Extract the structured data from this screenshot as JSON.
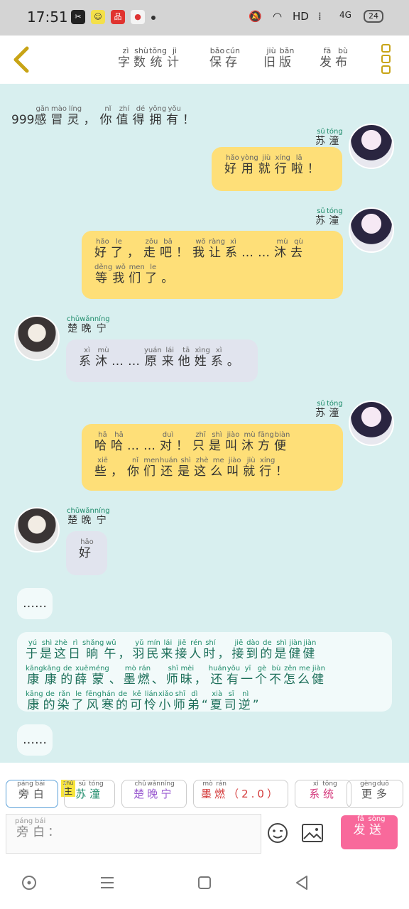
{
  "status": {
    "time": "17:51",
    "network": "HD",
    "signal": "4G",
    "battery": "24"
  },
  "header": {
    "stats": {
      "hanzi": [
        "字",
        "数",
        "统",
        "计"
      ],
      "pinyin": [
        "zì",
        "shù",
        "tǒng",
        "jì"
      ]
    },
    "save": {
      "hanzi": [
        "保",
        "存"
      ],
      "pinyin": [
        "bǎo",
        "cún"
      ]
    },
    "old": {
      "hanzi": [
        "旧",
        "版"
      ],
      "pinyin": [
        "jiù",
        "bǎn"
      ]
    },
    "publish": {
      "hanzi": [
        "发",
        "布"
      ],
      "pinyin": [
        "fā",
        "bù"
      ]
    }
  },
  "messages": {
    "m0": {
      "prefix": "999",
      "hanzi": [
        "感",
        "冒",
        "灵",
        "，",
        "你",
        "值",
        "得",
        "拥",
        "有",
        "！"
      ],
      "pinyin": [
        "gǎn",
        "mào",
        "líng",
        "",
        "nǐ",
        "zhí",
        "dé",
        "yōng",
        "yǒu",
        ""
      ]
    },
    "m1_speaker": {
      "hanzi": [
        "苏",
        "潼"
      ],
      "pinyin": [
        "sū",
        "tóng"
      ]
    },
    "m1": {
      "hanzi": [
        "好",
        "用",
        "就",
        "行",
        "啦",
        "！"
      ],
      "pinyin": [
        "hǎo",
        "yòng",
        "jiù",
        "xíng",
        "lā",
        ""
      ]
    },
    "m2_speaker": {
      "hanzi": [
        "苏",
        "潼"
      ],
      "pinyin": [
        "sū",
        "tóng"
      ]
    },
    "m2_l1": {
      "hanzi": [
        "好",
        "了",
        "，",
        "走",
        "吧",
        "！",
        "我",
        "让",
        "系",
        "……",
        "沐",
        "去"
      ],
      "pinyin": [
        "hǎo",
        "le",
        "",
        "zǒu",
        "bā",
        "",
        "wǒ",
        "ràng",
        "xì",
        "",
        "mù",
        "qù"
      ]
    },
    "m2_l2": {
      "hanzi": [
        "等",
        "我",
        "们",
        "了",
        "。"
      ],
      "pinyin": [
        "děng",
        "wǒ",
        "men",
        "le",
        ""
      ]
    },
    "m3_speaker": {
      "hanzi": [
        "楚",
        "晚",
        "宁"
      ],
      "pinyin": [
        "chǔ",
        "wǎn",
        "níng"
      ]
    },
    "m3": {
      "hanzi": [
        "系",
        "沐",
        "……",
        "原",
        "来",
        "他",
        "姓",
        "系",
        "。"
      ],
      "pinyin": [
        "xì",
        "mù",
        "",
        "yuán",
        "lái",
        "tā",
        "xìng",
        "xì",
        ""
      ]
    },
    "m4_speaker": {
      "hanzi": [
        "苏",
        "潼"
      ],
      "pinyin": [
        "sū",
        "tóng"
      ]
    },
    "m4_l1": {
      "hanzi": [
        "哈",
        "哈",
        "……",
        "对",
        "！",
        "只",
        "是",
        "叫",
        "沐",
        "方",
        "便"
      ],
      "pinyin": [
        "hā",
        "hā",
        "",
        "duì",
        "",
        "zhī",
        "shì",
        "jiào",
        "mù",
        "fāng",
        "biàn"
      ]
    },
    "m4_l2": {
      "hanzi": [
        "些",
        "，",
        "你",
        "们",
        "还",
        "是",
        "这",
        "么",
        "叫",
        "就",
        "行",
        "！"
      ],
      "pinyin": [
        "xiē",
        "",
        "nǐ",
        "men",
        "huán",
        "shì",
        "zhè",
        "me",
        "jiào",
        "jiù",
        "xíng",
        ""
      ]
    },
    "m5_speaker": {
      "hanzi": [
        "楚",
        "晚",
        "宁"
      ],
      "pinyin": [
        "chǔ",
        "wǎn",
        "níng"
      ]
    },
    "m5": {
      "hanzi": [
        "好"
      ],
      "pinyin": [
        "hǎo"
      ]
    },
    "ellipsis1": "……",
    "n1_l1": {
      "hanzi": [
        "于",
        "是",
        "这",
        "日",
        "晌",
        "午",
        "，",
        "羽",
        "民",
        "来",
        "接",
        "人",
        "时",
        "，",
        "接",
        "到",
        "的",
        "是",
        "健",
        "健"
      ],
      "pinyin": [
        "yú",
        "shì",
        "zhè",
        "rì",
        "shǎng",
        "wǔ",
        "",
        "yǔ",
        "mín",
        "lái",
        "jiē",
        "rén",
        "shí",
        "",
        "jiē",
        "dào",
        "de",
        "shì",
        "jiàn",
        "jiàn"
      ]
    },
    "n1_l2": {
      "hanzi": [
        "康",
        "康",
        "的",
        "薛",
        "蒙",
        "、",
        "墨",
        "燃",
        "、",
        "师",
        "昧",
        "，",
        "还",
        "有",
        "一",
        "个",
        "不",
        "怎",
        "么",
        "健"
      ],
      "pinyin": [
        "kāng",
        "kāng",
        "de",
        "xuē",
        "méng",
        "",
        "mò",
        "rán",
        "",
        "shī",
        "mèi",
        "",
        "huán",
        "yǒu",
        "yī",
        "gè",
        "bù",
        "zěn",
        "me",
        "jiàn"
      ]
    },
    "n1_l3": {
      "hanzi": [
        "康",
        "的",
        "染",
        "了",
        "风",
        "寒",
        "的",
        "可",
        "怜",
        "小",
        "师",
        "弟",
        "“",
        "夏",
        "司",
        "逆",
        "”"
      ],
      "pinyin": [
        "kāng",
        "de",
        "rǎn",
        "le",
        "fēng",
        "hán",
        "de",
        "kě",
        "lián",
        "xiǎo",
        "shī",
        "dì",
        "",
        "xià",
        "sī",
        "nì",
        ""
      ]
    },
    "ellipsis2": "……"
  },
  "roles": {
    "narrator": {
      "hanzi": [
        "旁",
        "白"
      ],
      "pinyin": [
        "páng",
        "bái"
      ]
    },
    "host": {
      "hanzi": [
        "主"
      ],
      "pinyin": [
        "zhǔ"
      ]
    },
    "sutong": {
      "hanzi": [
        "苏",
        "潼"
      ],
      "pinyin": [
        "sū",
        "tóng"
      ]
    },
    "chuwanning": {
      "hanzi": [
        "楚",
        "晚",
        "宁"
      ],
      "pinyin": [
        "chǔ",
        "wǎn",
        "níng"
      ]
    },
    "moran": {
      "hanzi": [
        "墨",
        "燃",
        "（",
        "2.0",
        "）"
      ],
      "pinyin": [
        "mò",
        "rán",
        "",
        "",
        ""
      ]
    },
    "system": {
      "hanzi": [
        "系",
        "统"
      ],
      "pinyin": [
        "xì",
        "tǒng"
      ]
    },
    "more": {
      "hanzi": [
        "更",
        "多"
      ],
      "pinyin": [
        "gèng",
        "duō"
      ]
    }
  },
  "input": {
    "hanzi": [
      "旁",
      "白",
      "："
    ],
    "pinyin": [
      "páng",
      "bái",
      ""
    ]
  },
  "send": {
    "hanzi": [
      "发",
      "送"
    ],
    "pinyin": [
      "fā",
      "sòng"
    ]
  },
  "colors": {
    "chat_bg": "#d8efef",
    "yellow_bubble": "#fedf78",
    "gray_bubble": "#e1e4ee",
    "send": "#f8699b",
    "pinyin_green": "#1d8b6a",
    "accent_gold": "#c8a416"
  }
}
